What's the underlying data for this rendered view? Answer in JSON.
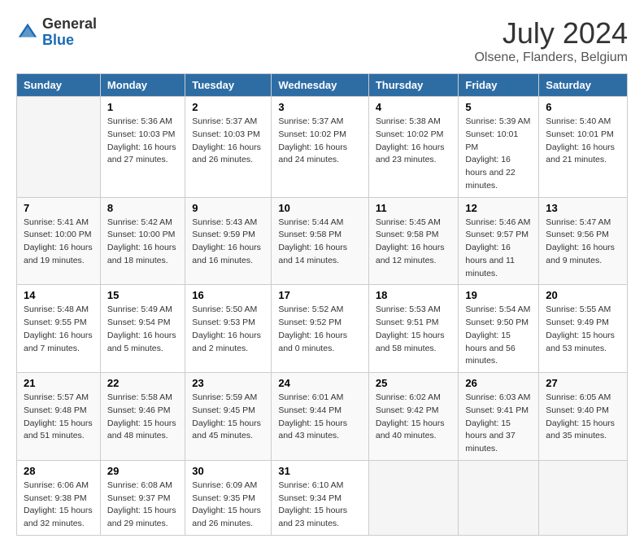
{
  "header": {
    "logo_general": "General",
    "logo_blue": "Blue",
    "month_year": "July 2024",
    "location": "Olsene, Flanders, Belgium"
  },
  "days_of_week": [
    "Sunday",
    "Monday",
    "Tuesday",
    "Wednesday",
    "Thursday",
    "Friday",
    "Saturday"
  ],
  "weeks": [
    [
      {
        "day": "",
        "sunrise": "",
        "sunset": "",
        "daylight": "",
        "empty": true
      },
      {
        "day": "1",
        "sunrise": "Sunrise: 5:36 AM",
        "sunset": "Sunset: 10:03 PM",
        "daylight": "Daylight: 16 hours and 27 minutes."
      },
      {
        "day": "2",
        "sunrise": "Sunrise: 5:37 AM",
        "sunset": "Sunset: 10:03 PM",
        "daylight": "Daylight: 16 hours and 26 minutes."
      },
      {
        "day": "3",
        "sunrise": "Sunrise: 5:37 AM",
        "sunset": "Sunset: 10:02 PM",
        "daylight": "Daylight: 16 hours and 24 minutes."
      },
      {
        "day": "4",
        "sunrise": "Sunrise: 5:38 AM",
        "sunset": "Sunset: 10:02 PM",
        "daylight": "Daylight: 16 hours and 23 minutes."
      },
      {
        "day": "5",
        "sunrise": "Sunrise: 5:39 AM",
        "sunset": "Sunset: 10:01 PM",
        "daylight": "Daylight: 16 hours and 22 minutes."
      },
      {
        "day": "6",
        "sunrise": "Sunrise: 5:40 AM",
        "sunset": "Sunset: 10:01 PM",
        "daylight": "Daylight: 16 hours and 21 minutes."
      }
    ],
    [
      {
        "day": "7",
        "sunrise": "Sunrise: 5:41 AM",
        "sunset": "Sunset: 10:00 PM",
        "daylight": "Daylight: 16 hours and 19 minutes."
      },
      {
        "day": "8",
        "sunrise": "Sunrise: 5:42 AM",
        "sunset": "Sunset: 10:00 PM",
        "daylight": "Daylight: 16 hours and 18 minutes."
      },
      {
        "day": "9",
        "sunrise": "Sunrise: 5:43 AM",
        "sunset": "Sunset: 9:59 PM",
        "daylight": "Daylight: 16 hours and 16 minutes."
      },
      {
        "day": "10",
        "sunrise": "Sunrise: 5:44 AM",
        "sunset": "Sunset: 9:58 PM",
        "daylight": "Daylight: 16 hours and 14 minutes."
      },
      {
        "day": "11",
        "sunrise": "Sunrise: 5:45 AM",
        "sunset": "Sunset: 9:58 PM",
        "daylight": "Daylight: 16 hours and 12 minutes."
      },
      {
        "day": "12",
        "sunrise": "Sunrise: 5:46 AM",
        "sunset": "Sunset: 9:57 PM",
        "daylight": "Daylight: 16 hours and 11 minutes."
      },
      {
        "day": "13",
        "sunrise": "Sunrise: 5:47 AM",
        "sunset": "Sunset: 9:56 PM",
        "daylight": "Daylight: 16 hours and 9 minutes."
      }
    ],
    [
      {
        "day": "14",
        "sunrise": "Sunrise: 5:48 AM",
        "sunset": "Sunset: 9:55 PM",
        "daylight": "Daylight: 16 hours and 7 minutes."
      },
      {
        "day": "15",
        "sunrise": "Sunrise: 5:49 AM",
        "sunset": "Sunset: 9:54 PM",
        "daylight": "Daylight: 16 hours and 5 minutes."
      },
      {
        "day": "16",
        "sunrise": "Sunrise: 5:50 AM",
        "sunset": "Sunset: 9:53 PM",
        "daylight": "Daylight: 16 hours and 2 minutes."
      },
      {
        "day": "17",
        "sunrise": "Sunrise: 5:52 AM",
        "sunset": "Sunset: 9:52 PM",
        "daylight": "Daylight: 16 hours and 0 minutes."
      },
      {
        "day": "18",
        "sunrise": "Sunrise: 5:53 AM",
        "sunset": "Sunset: 9:51 PM",
        "daylight": "Daylight: 15 hours and 58 minutes."
      },
      {
        "day": "19",
        "sunrise": "Sunrise: 5:54 AM",
        "sunset": "Sunset: 9:50 PM",
        "daylight": "Daylight: 15 hours and 56 minutes."
      },
      {
        "day": "20",
        "sunrise": "Sunrise: 5:55 AM",
        "sunset": "Sunset: 9:49 PM",
        "daylight": "Daylight: 15 hours and 53 minutes."
      }
    ],
    [
      {
        "day": "21",
        "sunrise": "Sunrise: 5:57 AM",
        "sunset": "Sunset: 9:48 PM",
        "daylight": "Daylight: 15 hours and 51 minutes."
      },
      {
        "day": "22",
        "sunrise": "Sunrise: 5:58 AM",
        "sunset": "Sunset: 9:46 PM",
        "daylight": "Daylight: 15 hours and 48 minutes."
      },
      {
        "day": "23",
        "sunrise": "Sunrise: 5:59 AM",
        "sunset": "Sunset: 9:45 PM",
        "daylight": "Daylight: 15 hours and 45 minutes."
      },
      {
        "day": "24",
        "sunrise": "Sunrise: 6:01 AM",
        "sunset": "Sunset: 9:44 PM",
        "daylight": "Daylight: 15 hours and 43 minutes."
      },
      {
        "day": "25",
        "sunrise": "Sunrise: 6:02 AM",
        "sunset": "Sunset: 9:42 PM",
        "daylight": "Daylight: 15 hours and 40 minutes."
      },
      {
        "day": "26",
        "sunrise": "Sunrise: 6:03 AM",
        "sunset": "Sunset: 9:41 PM",
        "daylight": "Daylight: 15 hours and 37 minutes."
      },
      {
        "day": "27",
        "sunrise": "Sunrise: 6:05 AM",
        "sunset": "Sunset: 9:40 PM",
        "daylight": "Daylight: 15 hours and 35 minutes."
      }
    ],
    [
      {
        "day": "28",
        "sunrise": "Sunrise: 6:06 AM",
        "sunset": "Sunset: 9:38 PM",
        "daylight": "Daylight: 15 hours and 32 minutes."
      },
      {
        "day": "29",
        "sunrise": "Sunrise: 6:08 AM",
        "sunset": "Sunset: 9:37 PM",
        "daylight": "Daylight: 15 hours and 29 minutes."
      },
      {
        "day": "30",
        "sunrise": "Sunrise: 6:09 AM",
        "sunset": "Sunset: 9:35 PM",
        "daylight": "Daylight: 15 hours and 26 minutes."
      },
      {
        "day": "31",
        "sunrise": "Sunrise: 6:10 AM",
        "sunset": "Sunset: 9:34 PM",
        "daylight": "Daylight: 15 hours and 23 minutes."
      },
      {
        "day": "",
        "sunrise": "",
        "sunset": "",
        "daylight": "",
        "empty": true
      },
      {
        "day": "",
        "sunrise": "",
        "sunset": "",
        "daylight": "",
        "empty": true
      },
      {
        "day": "",
        "sunrise": "",
        "sunset": "",
        "daylight": "",
        "empty": true
      }
    ]
  ]
}
